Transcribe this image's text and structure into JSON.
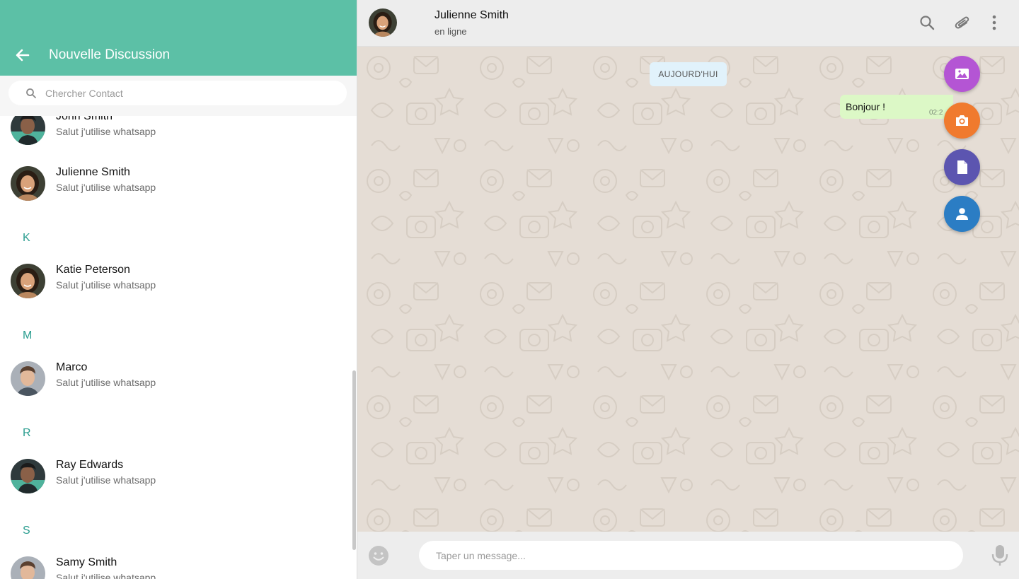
{
  "colors": {
    "header_green": "#5cc0a6",
    "section_letter": "#2a9d8f",
    "chat_bg": "#e5ddd5",
    "bubble_out": "#dcf8c6",
    "date_chip": "#e1f2fb",
    "fab_gallery": "#b455d4",
    "fab_camera": "#f07a2e",
    "fab_document": "#5c55b0",
    "fab_contact": "#2b7dc4"
  },
  "left_panel": {
    "title": "Nouvelle Discussion",
    "back_icon": "arrow-left-icon",
    "search": {
      "icon": "search-icon",
      "placeholder": "Chercher Contact",
      "value": ""
    },
    "contacts": [
      {
        "name": "John Smith",
        "status": "Salut j'utilise whatsapp",
        "avatar": "avatar-man-dark-hair"
      },
      {
        "name": "Julienne Smith",
        "status": "Salut j'utilise whatsapp",
        "avatar": "avatar-woman"
      },
      {
        "section": "K"
      },
      {
        "name": "Katie Peterson",
        "status": "Salut j'utilise whatsapp",
        "avatar": "avatar-woman"
      },
      {
        "section": "M"
      },
      {
        "name": "Marco",
        "status": "Salut j'utilise whatsapp",
        "avatar": "avatar-man-light"
      },
      {
        "section": "R"
      },
      {
        "name": "Ray Edwards",
        "status": "Salut j'utilise whatsapp",
        "avatar": "avatar-man-dark-hair"
      },
      {
        "section": "S"
      },
      {
        "name": "Samy Smith",
        "status": "Salut j'utilise whatsapp",
        "avatar": "avatar-man-light"
      }
    ]
  },
  "chat": {
    "contact_name": "Julienne Smith",
    "presence": "en ligne",
    "header_icons": [
      "search-icon",
      "paperclip-icon",
      "more-vertical-icon"
    ],
    "date_label": "AUJOURD'HUI",
    "messages": [
      {
        "direction": "out",
        "text": "Bonjour !",
        "time": "02:2"
      }
    ],
    "attach_menu": [
      "image-icon",
      "camera-icon",
      "document-icon",
      "contact-icon"
    ],
    "composer": {
      "emoji_icon": "emoji-icon",
      "placeholder": "Taper un message...",
      "value": "",
      "mic_icon": "microphone-icon"
    }
  }
}
